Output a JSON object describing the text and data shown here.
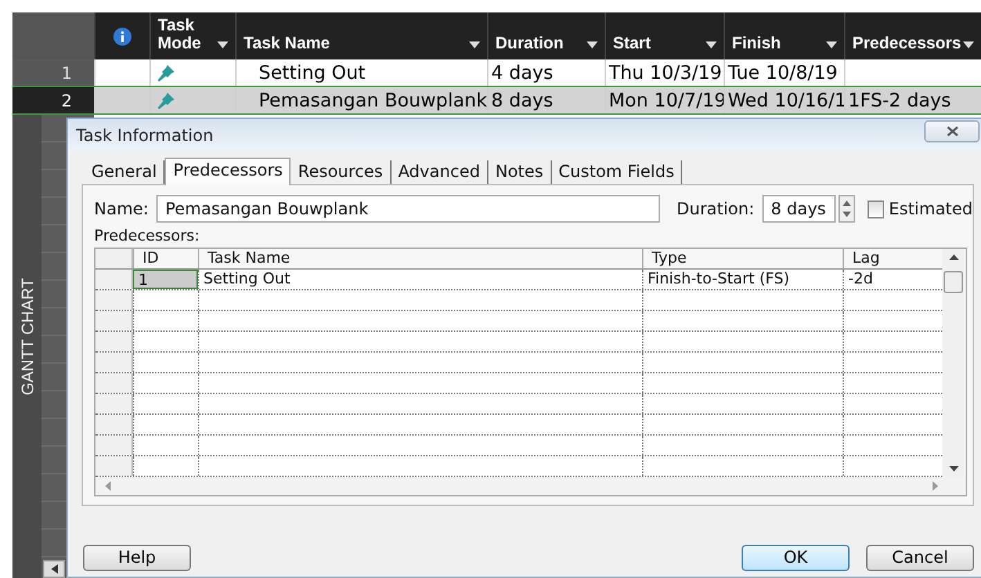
{
  "side_label": "GANTT CHART",
  "sheet": {
    "columns": [
      {
        "kind": "info"
      },
      {
        "kind": "text",
        "label": "Task Mode",
        "dropdown": true
      },
      {
        "kind": "text",
        "label": "Task Name",
        "dropdown": true
      },
      {
        "kind": "text",
        "label": "Duration",
        "dropdown": true
      },
      {
        "kind": "text",
        "label": "Start",
        "dropdown": true
      },
      {
        "kind": "text",
        "label": "Finish",
        "dropdown": true
      },
      {
        "kind": "text",
        "label": "Predecessors",
        "dropdown": true
      }
    ],
    "rows": [
      {
        "number": "1",
        "selected": false,
        "task_name": "Setting Out",
        "duration": "4 days",
        "start": "Thu 10/3/19",
        "finish": "Tue 10/8/19",
        "predecessors": ""
      },
      {
        "number": "2",
        "selected": true,
        "task_name": "Pemasangan Bouwplank",
        "duration": "8 days",
        "start": "Mon 10/7/19",
        "finish": "Wed 10/16/1",
        "predecessors": "1FS-2 days"
      }
    ]
  },
  "dialog": {
    "title": "Task Information",
    "tabs": [
      {
        "label": "General",
        "selected": false
      },
      {
        "label": "Predecessors",
        "selected": true
      },
      {
        "label": "Resources",
        "selected": false
      },
      {
        "label": "Advanced",
        "selected": false
      },
      {
        "label": "Notes",
        "selected": false
      },
      {
        "label": "Custom Fields",
        "selected": false
      }
    ],
    "name_label": "Name:",
    "name_value": "Pemasangan Bouwplank",
    "duration_label": "Duration:",
    "duration_value": "8 days",
    "estimated": {
      "label": "Estimated",
      "checked": false
    },
    "predecessors_label": "Predecessors:",
    "grid": {
      "columns": [
        "ID",
        "Task Name",
        "Type",
        "Lag"
      ],
      "rows": [
        {
          "id": "1",
          "task_name": "Setting Out",
          "type": "Finish-to-Start (FS)",
          "lag": "-2d"
        }
      ]
    },
    "buttons": [
      {
        "label": "Help",
        "kind": "normal"
      },
      {
        "label": "OK",
        "kind": "default"
      },
      {
        "label": "Cancel",
        "kind": "normal"
      }
    ]
  }
}
